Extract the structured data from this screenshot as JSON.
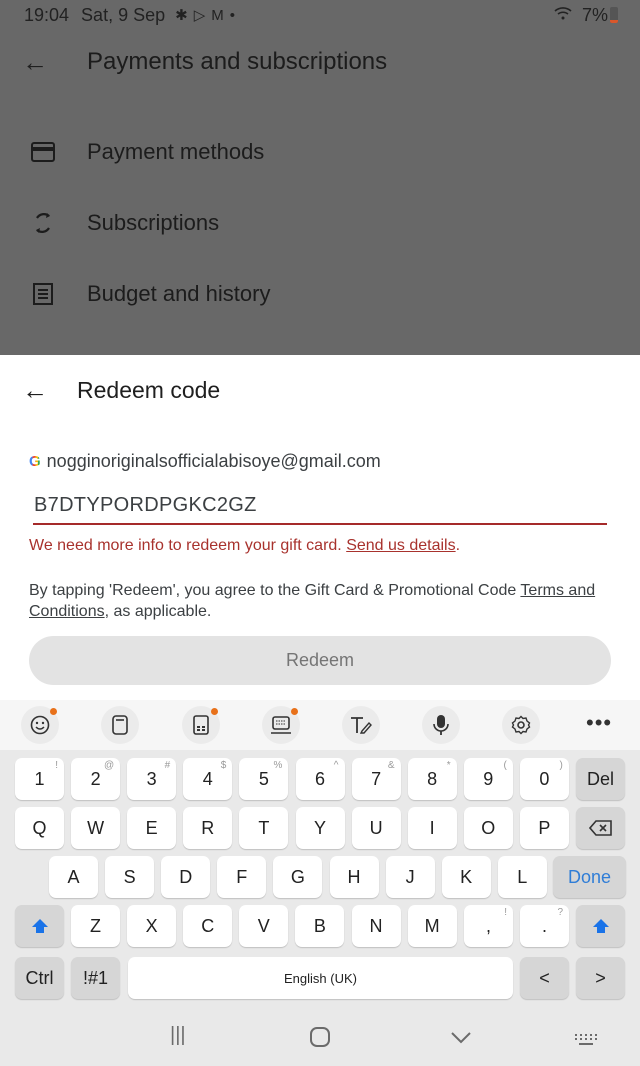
{
  "status_bar": {
    "time": "19:04",
    "date": "Sat, 9 Sep",
    "notification_icons": [
      "gear-icon",
      "play-store-icon",
      "gmail-icon",
      "dot-icon"
    ],
    "battery_percent": "7%"
  },
  "background_page": {
    "title": "Payments and subscriptions",
    "items": [
      {
        "label": "Payment methods",
        "icon": "credit-card-icon"
      },
      {
        "label": "Subscriptions",
        "icon": "sync-icon"
      },
      {
        "label": "Budget and history",
        "icon": "receipt-icon"
      }
    ]
  },
  "sheet": {
    "title": "Redeem code",
    "account_email": "nogginoriginalsofficialabisoye@gmail.com",
    "code_value": "B7DTYPORDPGKC2GZ",
    "error_text": "We need more info to redeem your gift card. ",
    "error_link": "Send us details",
    "error_suffix": ".",
    "terms_prefix": "By tapping 'Redeem', you agree to the Gift Card & Promotional Code ",
    "terms_link": "Terms and Conditions",
    "terms_suffix": ", as applicable.",
    "redeem_label": "Redeem",
    "colors": {
      "error": "#a8322d",
      "underline": "#a52a2a"
    }
  },
  "keyboard": {
    "toolbar": [
      "emoji-icon",
      "clipboard-icon",
      "one-handed-icon",
      "keyboard-mode-icon",
      "handwriting-icon",
      "mic-icon",
      "settings-icon",
      "more-icon"
    ],
    "row1": [
      {
        "k": "1",
        "s": "!"
      },
      {
        "k": "2",
        "s": "@"
      },
      {
        "k": "3",
        "s": "#"
      },
      {
        "k": "4",
        "s": "$"
      },
      {
        "k": "5",
        "s": "%"
      },
      {
        "k": "6",
        "s": "^"
      },
      {
        "k": "7",
        "s": "&"
      },
      {
        "k": "8",
        "s": "*"
      },
      {
        "k": "9",
        "s": "("
      },
      {
        "k": "0",
        "s": ")"
      }
    ],
    "del_label": "Del",
    "row2": [
      "Q",
      "W",
      "E",
      "R",
      "T",
      "Y",
      "U",
      "I",
      "O",
      "P"
    ],
    "row3": [
      "A",
      "S",
      "D",
      "F",
      "G",
      "H",
      "J",
      "K",
      "L"
    ],
    "done_label": "Done",
    "row4": [
      "Z",
      "X",
      "C",
      "V",
      "B",
      "N",
      "M"
    ],
    "comma": {
      "k": ",",
      "s": "!"
    },
    "period": {
      "k": ".",
      "s": "?"
    },
    "ctrl_label": "Ctrl",
    "symbols_label": "!#1",
    "space_label": "English (UK)",
    "left_label": "<",
    "right_label": ">"
  },
  "navbar": {
    "recents": "|||",
    "home": "○",
    "back": "⌄",
    "keyboard": "keyboard-hide-icon"
  }
}
